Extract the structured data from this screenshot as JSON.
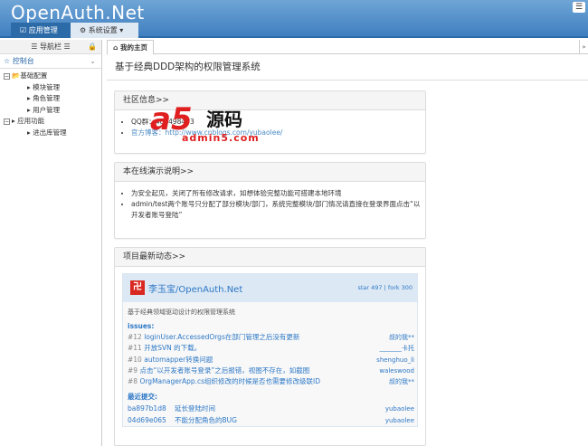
{
  "header": {
    "logo": "OpenAuth.Net",
    "nav": [
      {
        "label": "☑ 应用管理",
        "icon": "checkbox-icon"
      },
      {
        "label": "⚙ 系统设置 ▾",
        "icon": "gear-icon"
      }
    ],
    "menu_icon": "☰"
  },
  "sidebar": {
    "title": "☰ 导航栏 ☰",
    "lock_icon": "🔒",
    "console": "☆ 控制台",
    "console_chevron": "⌄",
    "tree": [
      {
        "label": "基础配置",
        "children": [
          "模块管理",
          "角色管理",
          "用户管理"
        ]
      },
      {
        "label": "应用功能",
        "children": [
          "进出库管理"
        ]
      }
    ]
  },
  "main": {
    "tab": "⌂ 我的主页",
    "tab_scroll": "»",
    "title": "基于经典DDD架构的权限管理系统",
    "cards": [
      {
        "title": "社区信息>>",
        "items": [
          "QQ群：484498493",
          "官方博客：http://www.cnblogs.com/yubaolee/"
        ]
      },
      {
        "title": "本在线演示说明>>",
        "items": [
          "为安全起见，关闭了所有修改请求，如想体验完整功能可搭建本地环境",
          "admin/test两个账号只分配了部分模块/部门，系统完整模块/部门情况请直接在登录界面点击“以开发者账号登陆”"
        ]
      },
      {
        "title": "项目最新动态>>"
      }
    ],
    "watermark": {
      "a": "a5",
      "text": "源码",
      "domain": "admin5.com"
    },
    "gitee": {
      "icon": "卍",
      "name": "李玉宝/OpenAuth.Net",
      "stats": "star 497 | fork 300",
      "desc": "基于经典领域驱动设计的权限管理系统",
      "issues_label": "issues:",
      "issues": [
        {
          "num": "#12",
          "title": "loginUser.AccessedOrgs在部门管理之后没有更新",
          "author": "叔的我**"
        },
        {
          "num": "#11",
          "title": "开放SVN 的下载。",
          "author": "_______卡托"
        },
        {
          "num": "#10",
          "title": "automapper转换问题",
          "author": "shenghuo_li"
        },
        {
          "num": "#9",
          "title": "点击“以开发者账号登录”之后报错，视图不存在，如截图",
          "author": "waleswood"
        },
        {
          "num": "#8",
          "title": "OrgManagerApp.cs组织修改的时候是否也需要修改级联ID",
          "author": "叔的我**"
        }
      ],
      "commits_label": "最近提交:",
      "commits": [
        {
          "hash": "ba897b1d8",
          "msg": "延长登陆时间",
          "author": "yubaolee"
        },
        {
          "hash": "04d69e065",
          "msg": "不能分配角色的BUG",
          "author": "yubaolee"
        }
      ]
    }
  }
}
